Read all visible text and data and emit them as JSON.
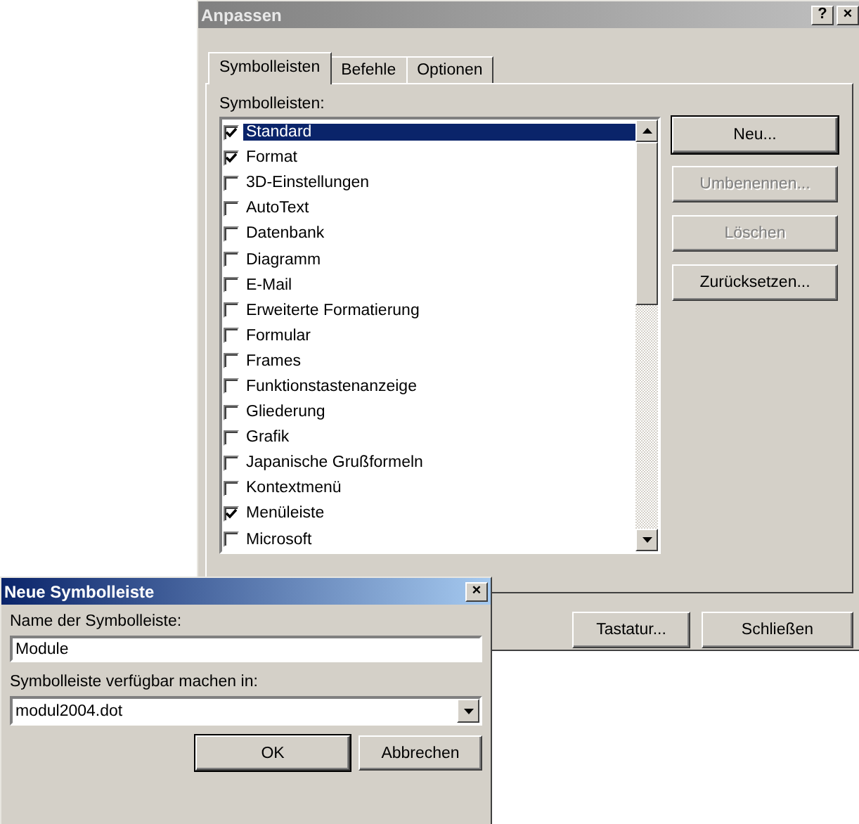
{
  "main_dialog": {
    "title": "Anpassen",
    "help_button": "?",
    "close_button": "×",
    "tabs": [
      {
        "label": "Symbolleisten",
        "selected": true
      },
      {
        "label": "Befehle",
        "selected": false
      },
      {
        "label": "Optionen",
        "selected": false
      }
    ],
    "list_label": "Symbolleisten:",
    "toolbars": [
      {
        "label": "Standard",
        "checked": true,
        "selected": true
      },
      {
        "label": "Format",
        "checked": true,
        "selected": false
      },
      {
        "label": "3D-Einstellungen",
        "checked": false,
        "selected": false
      },
      {
        "label": "AutoText",
        "checked": false,
        "selected": false
      },
      {
        "label": "Datenbank",
        "checked": false,
        "selected": false
      },
      {
        "label": "Diagramm",
        "checked": false,
        "selected": false
      },
      {
        "label": "E-Mail",
        "checked": false,
        "selected": false
      },
      {
        "label": "Erweiterte Formatierung",
        "checked": false,
        "selected": false
      },
      {
        "label": "Formular",
        "checked": false,
        "selected": false
      },
      {
        "label": "Frames",
        "checked": false,
        "selected": false
      },
      {
        "label": "Funktionstastenanzeige",
        "checked": false,
        "selected": false
      },
      {
        "label": "Gliederung",
        "checked": false,
        "selected": false
      },
      {
        "label": "Grafik",
        "checked": false,
        "selected": false
      },
      {
        "label": "Japanische Grußformeln",
        "checked": false,
        "selected": false
      },
      {
        "label": "Kontextmenü",
        "checked": false,
        "selected": false
      },
      {
        "label": "Menüleiste",
        "checked": true,
        "selected": false
      },
      {
        "label": "Microsoft",
        "checked": false,
        "selected": false
      }
    ],
    "side_buttons": [
      {
        "label": "Neu...",
        "disabled": false,
        "default": true
      },
      {
        "label": "Umbenennen...",
        "disabled": true,
        "default": false
      },
      {
        "label": "Löschen",
        "disabled": true,
        "default": false
      },
      {
        "label": "Zurücksetzen...",
        "disabled": false,
        "default": false
      }
    ],
    "bottom_buttons": [
      {
        "label": "Tastatur..."
      },
      {
        "label": "Schließen"
      }
    ]
  },
  "new_toolbar_dialog": {
    "title": "Neue Symbolleiste",
    "close_button": "×",
    "name_label": "Name der Symbolleiste:",
    "name_value": "Module",
    "location_label": "Symbolleiste verfügbar machen in:",
    "location_value": "modul2004.dot",
    "buttons": [
      {
        "label": "OK",
        "default": true
      },
      {
        "label": "Abbrechen",
        "default": false
      }
    ]
  }
}
